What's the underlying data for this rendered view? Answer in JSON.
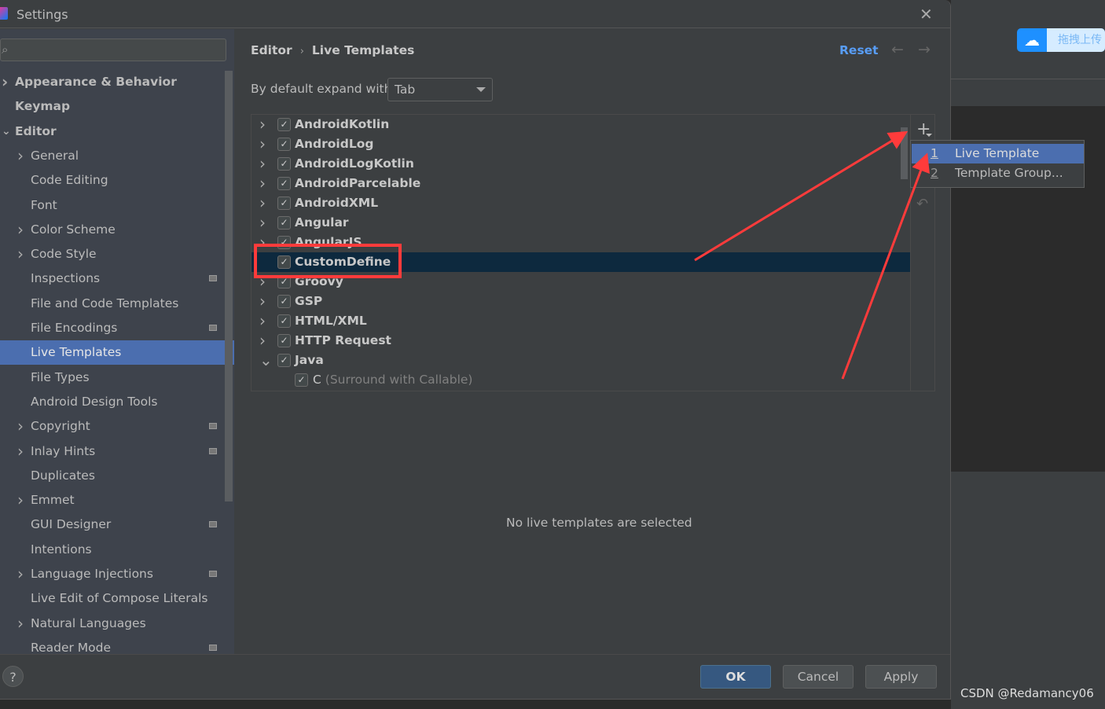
{
  "window": {
    "title": "Settings"
  },
  "external": {
    "upload_label": "拖拽上传",
    "watermark": "CSDN @Redamancy06"
  },
  "sidebar": {
    "search_placeholder": "",
    "items": [
      {
        "label": "Appearance & Behavior",
        "level": 0,
        "arrow": "right",
        "bold": true
      },
      {
        "label": "Keymap",
        "level": 0,
        "bold": true
      },
      {
        "label": "Editor",
        "level": 0,
        "arrow": "down",
        "bold": true
      },
      {
        "label": "General",
        "level": 1,
        "arrow": "right"
      },
      {
        "label": "Code Editing",
        "level": 1
      },
      {
        "label": "Font",
        "level": 1
      },
      {
        "label": "Color Scheme",
        "level": 1,
        "arrow": "right"
      },
      {
        "label": "Code Style",
        "level": 1,
        "arrow": "right"
      },
      {
        "label": "Inspections",
        "level": 1,
        "badge": true
      },
      {
        "label": "File and Code Templates",
        "level": 1
      },
      {
        "label": "File Encodings",
        "level": 1,
        "badge": true
      },
      {
        "label": "Live Templates",
        "level": 1,
        "selected": true
      },
      {
        "label": "File Types",
        "level": 1
      },
      {
        "label": "Android Design Tools",
        "level": 1
      },
      {
        "label": "Copyright",
        "level": 1,
        "arrow": "right",
        "badge": true
      },
      {
        "label": "Inlay Hints",
        "level": 1,
        "arrow": "right",
        "badge": true
      },
      {
        "label": "Duplicates",
        "level": 1
      },
      {
        "label": "Emmet",
        "level": 1,
        "arrow": "right"
      },
      {
        "label": "GUI Designer",
        "level": 1,
        "badge": true
      },
      {
        "label": "Intentions",
        "level": 1
      },
      {
        "label": "Language Injections",
        "level": 1,
        "arrow": "right",
        "badge": true
      },
      {
        "label": "Live Edit of Compose Literals",
        "level": 1
      },
      {
        "label": "Natural Languages",
        "level": 1,
        "arrow": "right"
      },
      {
        "label": "Reader Mode",
        "level": 1,
        "badge": true
      }
    ]
  },
  "header": {
    "breadcrumb": [
      "Editor",
      "Live Templates"
    ],
    "reset": "Reset"
  },
  "expand": {
    "label": "By default expand with",
    "value": "Tab"
  },
  "tree": [
    {
      "label": "AndroidKotlin",
      "checked": true,
      "arrow": "right"
    },
    {
      "label": "AndroidLog",
      "checked": true,
      "arrow": "right"
    },
    {
      "label": "AndroidLogKotlin",
      "checked": true,
      "arrow": "right"
    },
    {
      "label": "AndroidParcelable",
      "checked": true,
      "arrow": "right"
    },
    {
      "label": "AndroidXML",
      "checked": true,
      "arrow": "right"
    },
    {
      "label": "Angular",
      "checked": true,
      "arrow": "right"
    },
    {
      "label": "AngularJS",
      "checked": true,
      "arrow": "right"
    },
    {
      "label": "CustomDefine",
      "checked": true,
      "selected": true
    },
    {
      "label": "Groovy",
      "checked": true,
      "arrow": "right"
    },
    {
      "label": "GSP",
      "checked": true,
      "arrow": "right"
    },
    {
      "label": "HTML/XML",
      "checked": true,
      "arrow": "right"
    },
    {
      "label": "HTTP Request",
      "checked": true,
      "arrow": "right"
    },
    {
      "label": "Java",
      "checked": true,
      "arrow": "down"
    },
    {
      "label": "C",
      "desc": "(Surround with Callable)",
      "checked": true,
      "child": true
    }
  ],
  "add_menu": [
    {
      "num": "1",
      "label": "Live Template",
      "selected": true
    },
    {
      "num": "2",
      "label": "Template Group..."
    }
  ],
  "empty_message": "No live templates are selected",
  "buttons": {
    "ok": "OK",
    "cancel": "Cancel",
    "apply": "Apply",
    "help": "?"
  },
  "colors": {
    "accent": "#4b6eaf",
    "link": "#589df6",
    "annotation": "#ff3b3b",
    "selected_row": "#0d293e"
  }
}
